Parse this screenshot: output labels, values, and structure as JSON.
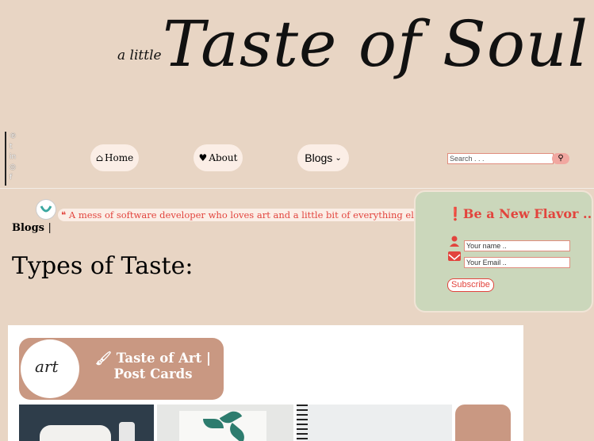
{
  "logo": {
    "small_text": "a little",
    "big_text": "Taste of Soul"
  },
  "social_icons": [
    "pinterest-icon",
    "tumblr-icon",
    "linkedin-icon",
    "instagram-icon",
    "facebook-icon"
  ],
  "social_glyphs": [
    "℗",
    "t",
    "in",
    "◎",
    "f"
  ],
  "nav": {
    "home": "Home",
    "about": "About",
    "blogs": "Blogs"
  },
  "search": {
    "placeholder": "Search . . ."
  },
  "tagline": "A mess of software developer who loves art and a little bit of everything else.",
  "breadcrumb": {
    "label": "Blogs",
    "separator": "|"
  },
  "page_title": "Types of Taste:",
  "subscribe": {
    "title": "Be a New Flavor ..",
    "name_placeholder": "Your name ..",
    "email_placeholder": "Your Email ..",
    "button": "Subscribe"
  },
  "category": {
    "avatar_text": "art",
    "title": "Taste of Art | Post Cards"
  },
  "colors": {
    "background": "#e8d5c4",
    "accent": "#e2443d",
    "panel": "#cbd7bb",
    "category": "#c99882"
  }
}
